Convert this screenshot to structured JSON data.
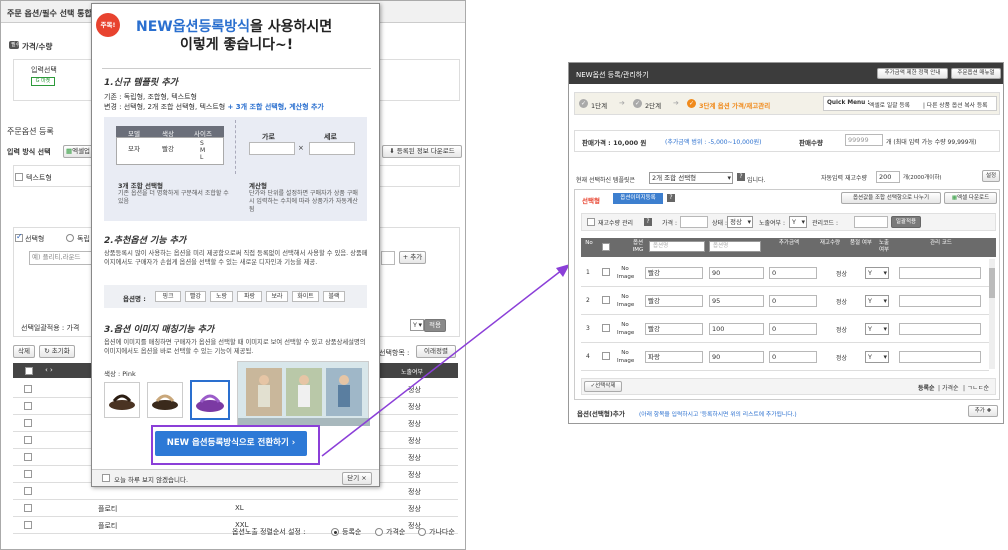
{
  "left": {
    "page_title": "주문 옵션/필수 선택 통합",
    "section_price": "가격/수량",
    "price_tag": "필수",
    "input_select_label": "입력선택",
    "mobile_badge": "G 마켓",
    "option_register_label": "주문옵션 등록",
    "input_method_label": "입력 방식 선택",
    "excel_upload": "엑셀업",
    "registered_info_download": "등록된 정보 다운로드",
    "text_type_label": "텍스트형",
    "select_type_label": "선택형",
    "independent_label": "독립",
    "example_placeholder": "예) 플리티,라운드",
    "add_button": "+ 추가",
    "bulk_apply_label": "선택일괄적용 : 가격",
    "bulk_select_value": "Y",
    "apply_button": "적용",
    "delete_button": "삭제",
    "reset_button": "초기화",
    "select_item_label": "선택항목 :",
    "all_select_button": "이래정렬",
    "expose_header": "노출여부",
    "rows": [
      {
        "name": "",
        "size": "",
        "status": "정상"
      },
      {
        "name": "",
        "size": "",
        "status": "정상"
      },
      {
        "name": "",
        "size": "",
        "status": "정상"
      },
      {
        "name": "",
        "size": "",
        "status": "정상"
      },
      {
        "name": "",
        "size": "",
        "status": "정상"
      },
      {
        "name": "",
        "size": "",
        "status": "정상"
      },
      {
        "name": "",
        "size": "",
        "status": "정상"
      },
      {
        "name": "플로티",
        "size": "XL",
        "status": "정상"
      },
      {
        "name": "플로티",
        "size": "XXL",
        "status": "정상"
      }
    ],
    "sort_label": "옵션노출 정렬순서 설정 :",
    "sort_options": [
      "등록순",
      "가격순",
      "가나다순"
    ]
  },
  "popup": {
    "badge": "주목!",
    "headline_highlight": "NEW옵션등록방식",
    "headline_rest": "을 사용하시면",
    "headline_line2": "이렇게 좋습니다~!",
    "s1_title": "1.신규 템플릿 추가",
    "s1_line1": "기존 : 독립형, 조합형, 텍스트형",
    "s1_line2_prefix": "변경 : 선택형, 2개 조합 선택형, 텍스트형",
    "s1_line2_highlight": "+ 3개 조합 선택형, 계산형 추가",
    "demo_table_headers": [
      "모델",
      "색상",
      "사이즈"
    ],
    "demo_table_cells": [
      "모자",
      "빨강",
      "S M L"
    ],
    "calc_width": "가로",
    "calc_height": "세로",
    "calc_times": "×",
    "cap1_title": "3개 조합 선택형",
    "cap1_text": "기존 옵션을 더 명확하게 구분해서 조합할 수 있음",
    "cap2_title": "계산형",
    "cap2_text": "단가와 단위를 설정하면 구매자가 상품 구매 시 입력하는 수치에 따라 상품가가 자동계산됨",
    "s2_title": "2.추천옵션 기능 추가",
    "s2_text": "상품등록시 많이 사용하는 옵션을 미리 제공함으로써 직접 등록없이 선택해서 사용할 수 있음. 상품페이지에서도 구매자가 손쉽게 옵션을 선택할 수 있는 새로운 디자인과 기능을 제공.",
    "s2_option_label": "옵션명 :",
    "s2_colors": [
      "핑크",
      "빨강",
      "노랑",
      "파랑",
      "보라",
      "화이트",
      "블랙"
    ],
    "s3_title": "3.옵션 이미지 매칭기능 추가",
    "s3_text": "옵션에 이미지를 매칭하면 구매자가 옵션을 선택할 때 이미지로 보여 선택할 수 있고 상품상세설명의 이미지에서도 옵션을 바로 선택할 수 있는 기능이 제공됨.",
    "color_label": "색상 : Pink",
    "cta_button": "NEW 옵션등록방식으로 전환하기 ›",
    "dont_show": "오늘 하루 보지 않겠습니다.",
    "close_button": "닫기 ×"
  },
  "right": {
    "window_title": "NEW옵션 등록/관리하기",
    "top_btn1": "추가금액 제한 정책 안내",
    "top_btn2": "주문옵션 매뉴얼",
    "steps": [
      "1단계",
      "2단계",
      "3단계 옵션 가격/재고관리"
    ],
    "quick_menu": "Quick Menu :",
    "quick1": "엑셀로 일괄 등록",
    "quick2": "다른 상품 옵션 복사 등록",
    "price_label": "판매가격 :",
    "price_value": "10,000",
    "price_unit": "원",
    "price_range": "(추가금액 범위 : -5,000~10,000원)",
    "qty_label": "판매수량",
    "qty_value": "99999",
    "qty_note": "개 (최대 입력 가능 수량 99,999개)",
    "current_template_label": "현재 선택하신 템플릿은",
    "template_value": "2개 조합 선택형",
    "template_suffix": "입니다.",
    "stock_label": "자동입력 재고수량",
    "stock_value": "200",
    "stock_note": "개(2000개이하)",
    "set_button": "설정",
    "tab_select": "선택형",
    "tab_image": "옵션이미지등록",
    "combine_button": "옵션값을 조합 선택항으로 나누기",
    "excel_download": "엑셀 다운로드",
    "filter_stock_manage": "재고수량 관리",
    "filter_price": "가격 :",
    "filter_status": "상태 :",
    "filter_status_value": "정상",
    "filter_expose": "노출여부 :",
    "filter_expose_value": "Y",
    "filter_manage_code": "관리코드 :",
    "bulk_apply": "일괄적용",
    "headers": [
      "No",
      "",
      "옵션 IMG",
      "옵션명",
      "옵션명",
      "추가금액",
      "재고수량",
      "품절 여부",
      "노출 여부",
      "관리 코드"
    ],
    "rows": [
      {
        "no": "1",
        "img": "No Image",
        "name": "빨강",
        "opt": "90",
        "price": "0",
        "status": "정상",
        "expose": "Y"
      },
      {
        "no": "2",
        "img": "No Image",
        "name": "빨강",
        "opt": "95",
        "price": "0",
        "status": "정상",
        "expose": "Y"
      },
      {
        "no": "3",
        "img": "No Image",
        "name": "빨강",
        "opt": "100",
        "price": "0",
        "status": "정상",
        "expose": "Y"
      },
      {
        "no": "4",
        "img": "No Image",
        "name": "파랑",
        "opt": "90",
        "price": "0",
        "status": "정상",
        "expose": "Y"
      }
    ],
    "delete_selected": "선택삭제",
    "sort_links": [
      "등록순",
      "가격순",
      "ㄱㄴㄷ순"
    ],
    "footer_title": "옵션(선택형)추가",
    "footer_note": "(아래 항목을 입력하시고 '등록하시면 위의 리스트에 추가됩니다.)",
    "add_button": "추가 ✚"
  },
  "colors": {
    "accent_blue": "#2a6fcf",
    "cta_blue": "#2d79d6",
    "highlight_purple": "#8b3fd8",
    "orange": "#f08a1c",
    "dark_header": "#3c3c3c"
  }
}
